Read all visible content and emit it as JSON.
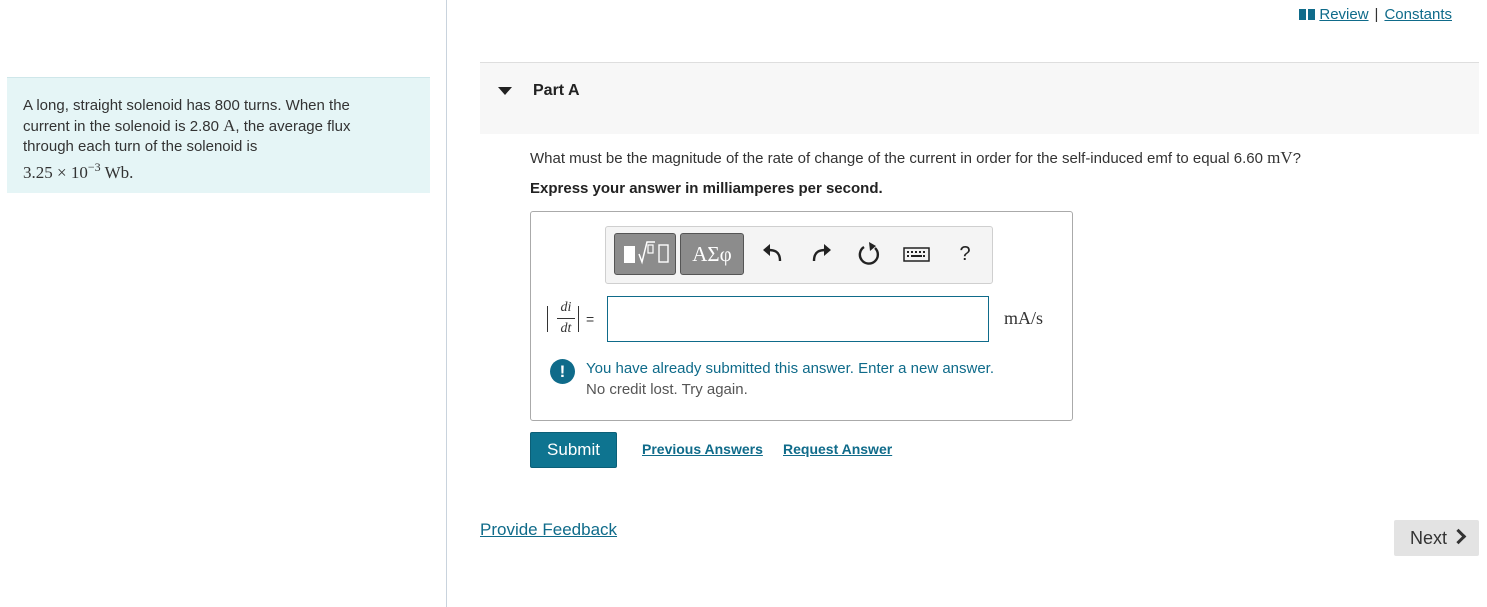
{
  "top_links": {
    "review": "Review",
    "separator": "|",
    "constants": "Constants"
  },
  "problem": {
    "line1": "A long, straight solenoid has 800 turns. When the",
    "line2_pre": "current in the solenoid is 2.80 ",
    "line2_unit": "A",
    "line2_post": ", the average flux",
    "line3": "through each turn of the solenoid is",
    "flux_mantissa": "3.25 × 10",
    "flux_exponent": "−3",
    "flux_unit": " Wb",
    "flux_end": "."
  },
  "part": {
    "title": "Part A",
    "question_pre": "What must be the magnitude of the rate of change of the current in order for the self-induced emf to equal 6.60 ",
    "question_unit": "mV",
    "question_end": "?",
    "instruction": "Express your answer in milliamperes per second."
  },
  "toolbar": {
    "greek_label": "ΑΣφ",
    "help_label": "?"
  },
  "answer": {
    "lhs_numerator": "di",
    "lhs_denominator": "dt",
    "equals": "=",
    "value": "",
    "units": "mA/s"
  },
  "alert": {
    "icon": "!",
    "line1": "You have already submitted this answer. Enter a new answer.",
    "line2": "No credit lost. Try again."
  },
  "actions": {
    "submit": "Submit",
    "previous_answers": "Previous Answers",
    "request_answer": "Request Answer",
    "provide_feedback": "Provide Feedback",
    "next": "Next"
  },
  "colors": {
    "accent": "#0f6b8a",
    "problem_bg": "#e5f5f6",
    "submit_bg": "#0e7490"
  }
}
